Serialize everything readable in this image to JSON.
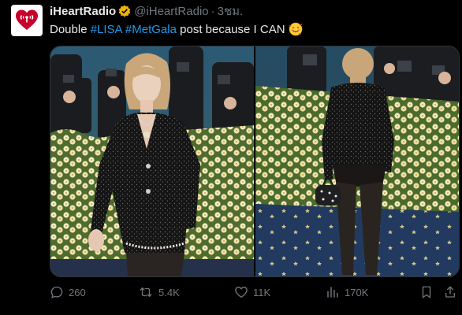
{
  "tweet": {
    "author_name": "iHeartRadio",
    "handle": "@iHeartRadio",
    "separator": "·",
    "time": "3ชม.",
    "text": {
      "lead": "Double ",
      "hashtag1": "#LISA",
      "hashtag2": "#MetGala",
      "tail": " post because I CAN"
    },
    "emoji": "smiling-face-with-hearts-icon"
  },
  "media": {
    "photos": [
      {
        "name": "lisa-front-photo"
      },
      {
        "name": "lisa-back-photo"
      }
    ]
  },
  "actions": {
    "replies": "260",
    "retweets": "5.4K",
    "likes": "11K",
    "views": "170K"
  },
  "colors": {
    "background": "#000000",
    "accent": "#1d9bf0",
    "muted": "#71767b",
    "verified": "#f4b400",
    "brand": "#c6002b"
  }
}
